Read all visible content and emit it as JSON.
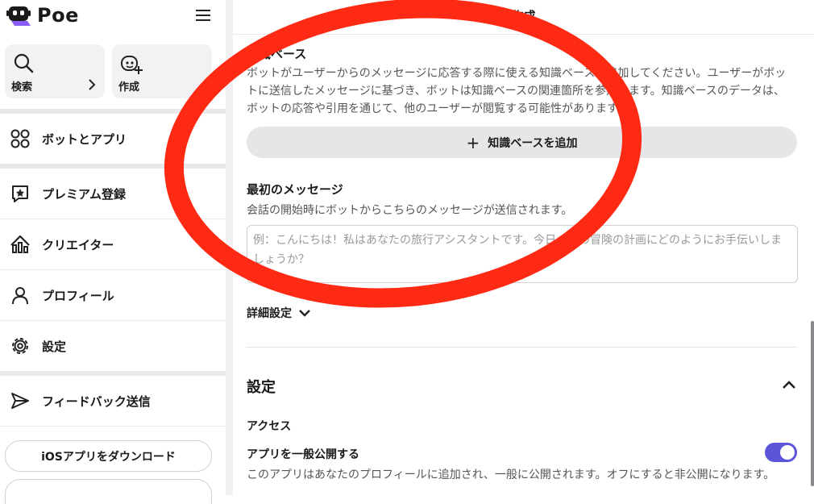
{
  "app": {
    "name": "Poe"
  },
  "sidebar": {
    "quick_actions": [
      {
        "label": "検索",
        "icon": "search-icon"
      },
      {
        "label": "作成",
        "icon": "create-bot-icon"
      }
    ],
    "items": [
      {
        "label": "ボットとアプリ",
        "icon": "bots-apps-icon"
      },
      {
        "label": "プレミアム登録",
        "icon": "premium-icon"
      },
      {
        "label": "クリエイター",
        "icon": "creator-icon"
      },
      {
        "label": "プロフィール",
        "icon": "profile-icon"
      },
      {
        "label": "設定",
        "icon": "gear-icon"
      },
      {
        "label": "フィードバック送信",
        "icon": "send-icon"
      }
    ],
    "download_label": "iOSアプリをダウンロード"
  },
  "header": {
    "title": "作成"
  },
  "knowledge_base": {
    "title": "知識ベース",
    "description": "ボットがユーザーからのメッセージに応答する際に使える知識ベースを追加してください。ユーザーがボットに送信したメッセージに基づき、ボットは知識ベースの関連箇所を参照します。知識ベースのデータは、ボットの応答や引用を通じて、他のユーザーが閲覧する可能性があります。",
    "add_label": "知識ベースを追加"
  },
  "first_message": {
    "title": "最初のメッセージ",
    "description": "会話の開始時にボットからこちらのメッセージが送信されます。",
    "placeholder": "例：こんにちは！私はあなたの旅行アシスタントです。今日、次の冒険の計画にどのようにお手伝いしましょうか？"
  },
  "advanced": {
    "label": "詳細設定"
  },
  "settings": {
    "title": "設定",
    "access_label": "アクセス",
    "public_toggle": {
      "label": "アプリを一般公開する",
      "description": "このアプリはあなたのプロフィールに追加され、一般に公開されます。オフにすると非公開になります。",
      "on": true
    }
  },
  "colors": {
    "accent": "#5b55d9",
    "annotation": "#ff2a14"
  }
}
